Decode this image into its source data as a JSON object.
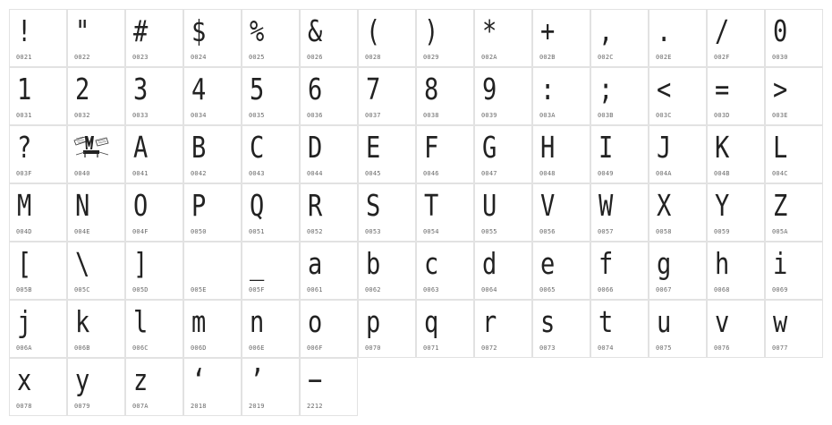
{
  "glyphs": [
    {
      "char": "!",
      "code": "0021"
    },
    {
      "char": "\"",
      "code": "0022"
    },
    {
      "char": "#",
      "code": "0023"
    },
    {
      "char": "$",
      "code": "0024"
    },
    {
      "char": "%",
      "code": "0025"
    },
    {
      "char": "&",
      "code": "0026"
    },
    {
      "char": "(",
      "code": "0028"
    },
    {
      "char": ")",
      "code": "0029"
    },
    {
      "char": "*",
      "code": "002A"
    },
    {
      "char": "+",
      "code": "002B"
    },
    {
      "char": ",",
      "code": "002C"
    },
    {
      "char": ".",
      "code": "002E"
    },
    {
      "char": "/",
      "code": "002F"
    },
    {
      "char": "0",
      "code": "0030"
    },
    {
      "char": "1",
      "code": "0031"
    },
    {
      "char": "2",
      "code": "0032"
    },
    {
      "char": "3",
      "code": "0033"
    },
    {
      "char": "4",
      "code": "0034"
    },
    {
      "char": "5",
      "code": "0035"
    },
    {
      "char": "6",
      "code": "0036"
    },
    {
      "char": "7",
      "code": "0037"
    },
    {
      "char": "8",
      "code": "0038"
    },
    {
      "char": "9",
      "code": "0039"
    },
    {
      "char": ":",
      "code": "003A"
    },
    {
      "char": ";",
      "code": "003B"
    },
    {
      "char": "<",
      "code": "003C"
    },
    {
      "char": "=",
      "code": "003D"
    },
    {
      "char": ">",
      "code": "003E"
    },
    {
      "char": "?",
      "code": "003F"
    },
    {
      "char": "",
      "code": "0040",
      "image": true
    },
    {
      "char": "A",
      "code": "0041"
    },
    {
      "char": "B",
      "code": "0042"
    },
    {
      "char": "C",
      "code": "0043"
    },
    {
      "char": "D",
      "code": "0044"
    },
    {
      "char": "E",
      "code": "0045"
    },
    {
      "char": "F",
      "code": "0046"
    },
    {
      "char": "G",
      "code": "0047"
    },
    {
      "char": "H",
      "code": "0048"
    },
    {
      "char": "I",
      "code": "0049"
    },
    {
      "char": "J",
      "code": "004A"
    },
    {
      "char": "K",
      "code": "004B"
    },
    {
      "char": "L",
      "code": "004C"
    },
    {
      "char": "M",
      "code": "004D"
    },
    {
      "char": "N",
      "code": "004E"
    },
    {
      "char": "O",
      "code": "004F"
    },
    {
      "char": "P",
      "code": "0050"
    },
    {
      "char": "Q",
      "code": "0051"
    },
    {
      "char": "R",
      "code": "0052"
    },
    {
      "char": "S",
      "code": "0053"
    },
    {
      "char": "T",
      "code": "0054"
    },
    {
      "char": "U",
      "code": "0055"
    },
    {
      "char": "V",
      "code": "0056"
    },
    {
      "char": "W",
      "code": "0057"
    },
    {
      "char": "X",
      "code": "0058"
    },
    {
      "char": "Y",
      "code": "0059"
    },
    {
      "char": "Z",
      "code": "005A"
    },
    {
      "char": "[",
      "code": "005B"
    },
    {
      "char": "\\",
      "code": "005C"
    },
    {
      "char": "]",
      "code": "005D"
    },
    {
      "char": "",
      "code": "005E"
    },
    {
      "char": "_",
      "code": "005F"
    },
    {
      "char": "a",
      "code": "0061"
    },
    {
      "char": "b",
      "code": "0062"
    },
    {
      "char": "c",
      "code": "0063"
    },
    {
      "char": "d",
      "code": "0064"
    },
    {
      "char": "e",
      "code": "0065"
    },
    {
      "char": "f",
      "code": "0066"
    },
    {
      "char": "g",
      "code": "0067"
    },
    {
      "char": "h",
      "code": "0068"
    },
    {
      "char": "i",
      "code": "0069"
    },
    {
      "char": "j",
      "code": "006A"
    },
    {
      "char": "k",
      "code": "006B"
    },
    {
      "char": "l",
      "code": "006C"
    },
    {
      "char": "m",
      "code": "006D"
    },
    {
      "char": "n",
      "code": "006E"
    },
    {
      "char": "o",
      "code": "006F"
    },
    {
      "char": "p",
      "code": "0070"
    },
    {
      "char": "q",
      "code": "0071"
    },
    {
      "char": "r",
      "code": "0072"
    },
    {
      "char": "s",
      "code": "0073"
    },
    {
      "char": "t",
      "code": "0074"
    },
    {
      "char": "u",
      "code": "0075"
    },
    {
      "char": "v",
      "code": "0076"
    },
    {
      "char": "w",
      "code": "0077"
    },
    {
      "char": "x",
      "code": "0078"
    },
    {
      "char": "y",
      "code": "0079"
    },
    {
      "char": "z",
      "code": "007A"
    },
    {
      "char": "‘",
      "code": "2018"
    },
    {
      "char": "’",
      "code": "2019"
    },
    {
      "char": "−",
      "code": "2212"
    }
  ]
}
